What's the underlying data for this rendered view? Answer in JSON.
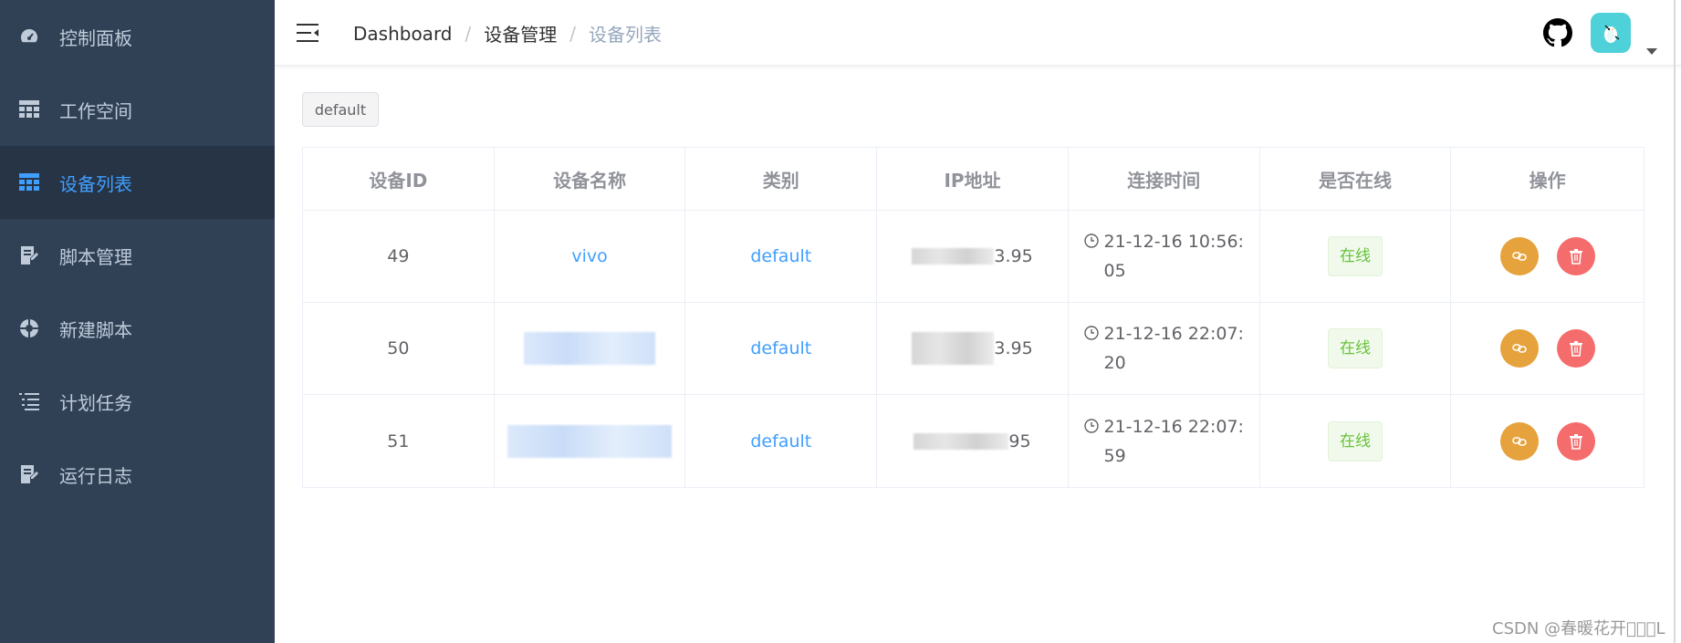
{
  "sidebar": {
    "items": [
      {
        "label": "控制面板",
        "icon": "dashboard-icon"
      },
      {
        "label": "工作空间",
        "icon": "grid-icon"
      },
      {
        "label": "设备列表",
        "icon": "grid-icon",
        "active": true
      },
      {
        "label": "脚本管理",
        "icon": "document-icon"
      },
      {
        "label": "新建脚本",
        "icon": "aperture-icon"
      },
      {
        "label": "计划任务",
        "icon": "list-icon"
      },
      {
        "label": "运行日志",
        "icon": "document-icon"
      }
    ]
  },
  "breadcrumb": [
    "Dashboard",
    "设备管理",
    "设备列表"
  ],
  "filter_tag": "default",
  "table": {
    "headers": [
      "设备ID",
      "设备名称",
      "类别",
      "IP地址",
      "连接时间",
      "是否在线",
      "操作"
    ],
    "rows": [
      {
        "id": "49",
        "name": "vivo",
        "category": "default",
        "ip_suffix": "3.95",
        "time_line1": "21-12-16 10:56:",
        "time_line2": "05",
        "status": "在线"
      },
      {
        "id": "50",
        "name": "",
        "category": "default",
        "ip_suffix": "3.95",
        "time_line1": "21-12-16 22:07:",
        "time_line2": "20",
        "status": "在线"
      },
      {
        "id": "51",
        "name": "",
        "category": "default",
        "ip_suffix": "95",
        "time_line1": "21-12-16 22:07:",
        "time_line2": "59",
        "status": "在线"
      }
    ]
  },
  "watermark": "CSDN @春暖花开\u0000\u0000\u0000L",
  "colors": {
    "sidebar_bg": "#304156",
    "active": "#409eff",
    "online": "#67c23a",
    "edit": "#e6a23c",
    "delete": "#f56c6c"
  }
}
